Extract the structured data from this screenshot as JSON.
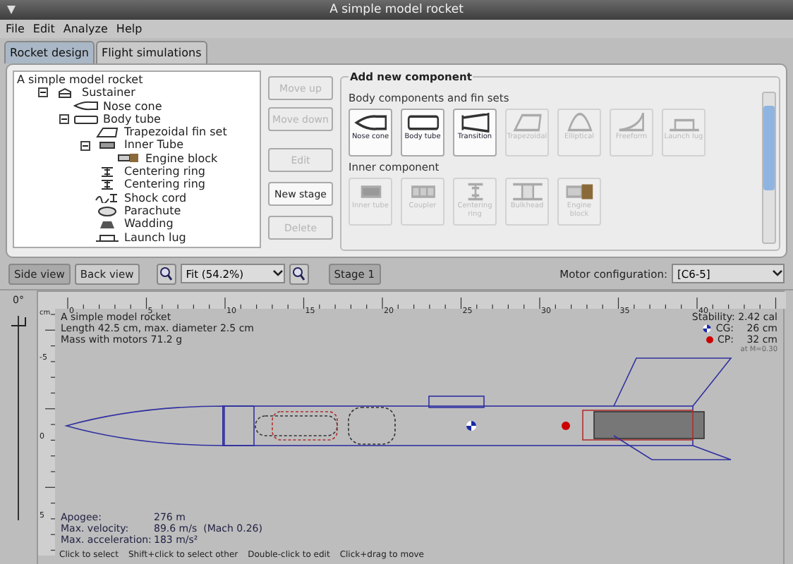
{
  "window": {
    "title": "A simple model rocket"
  },
  "menu": [
    "File",
    "Edit",
    "Analyze",
    "Help"
  ],
  "tabs": [
    {
      "label": "Rocket design",
      "selected": true
    },
    {
      "label": "Flight simulations",
      "selected": false
    }
  ],
  "tree": {
    "label": "A simple model rocket",
    "children": [
      {
        "label": "Sustainer",
        "kind": "stage",
        "expanded": true,
        "children": [
          {
            "label": "Nose cone",
            "kind": "nose"
          },
          {
            "label": "Body tube",
            "kind": "tube",
            "expanded": true,
            "children": [
              {
                "label": "Trapezoidal fin set",
                "kind": "fin"
              },
              {
                "label": "Inner Tube",
                "kind": "inner",
                "expanded": true,
                "children": [
                  {
                    "label": "Engine block",
                    "kind": "engine"
                  }
                ]
              },
              {
                "label": "Centering ring",
                "kind": "ring"
              },
              {
                "label": "Centering ring",
                "kind": "ring"
              },
              {
                "label": "Shock cord",
                "kind": "cord"
              },
              {
                "label": "Parachute",
                "kind": "chute"
              },
              {
                "label": "Wadding",
                "kind": "wadding"
              },
              {
                "label": "Launch lug",
                "kind": "lug"
              }
            ]
          }
        ]
      }
    ]
  },
  "actions": [
    {
      "label": "Move up",
      "disabled": true
    },
    {
      "label": "Move down",
      "disabled": true
    },
    {
      "label": "Edit",
      "disabled": true
    },
    {
      "label": "New stage",
      "disabled": false
    },
    {
      "label": "Delete",
      "disabled": true
    }
  ],
  "add_component": {
    "title": "Add new component",
    "groups": [
      {
        "title": "Body components and fin sets",
        "items": [
          {
            "label": "Nose cone",
            "kind": "nose",
            "disabled": false
          },
          {
            "label": "Body tube",
            "kind": "tube",
            "disabled": false
          },
          {
            "label": "Transition",
            "kind": "transition",
            "disabled": false
          },
          {
            "label": "Trapezoidal",
            "kind": "fin",
            "disabled": true
          },
          {
            "label": "Elliptical",
            "kind": "elliptical",
            "disabled": true
          },
          {
            "label": "Freeform",
            "kind": "freeform",
            "disabled": true
          },
          {
            "label": "Launch lug",
            "kind": "lug",
            "disabled": true
          }
        ]
      },
      {
        "title": "Inner component",
        "items": [
          {
            "label": "Inner tube",
            "kind": "inner",
            "disabled": true
          },
          {
            "label": "Coupler",
            "kind": "coupler",
            "disabled": true
          },
          {
            "label": "Centering ring",
            "kind": "ring",
            "disabled": true
          },
          {
            "label": "Bulkhead",
            "kind": "bulkhead",
            "disabled": true
          },
          {
            "label": "Engine block",
            "kind": "engine",
            "disabled": true
          }
        ]
      }
    ]
  },
  "toolbar": {
    "views": [
      {
        "label": "Side view",
        "selected": true
      },
      {
        "label": "Back view",
        "selected": false
      }
    ],
    "zoom": "Fit (54.2%)",
    "stage": "Stage 1",
    "motor_label": "Motor configuration:",
    "motor": "[C6-5]"
  },
  "view": {
    "angle": "0°",
    "rotation": {
      "level": 0
    },
    "unit": "cm",
    "xticks": [
      "0",
      "5",
      "10",
      "15",
      "20",
      "25",
      "30",
      "35",
      "40"
    ],
    "yticks": [
      "-5",
      "0",
      "5"
    ],
    "info": [
      "A simple model rocket",
      "Length 42.5 cm, max. diameter 2.5 cm",
      "Mass with motors  71.2 g"
    ],
    "stability": "Stability: 2.42 cal",
    "cg": {
      "label": "CG:",
      "value": "26 cm"
    },
    "cp": {
      "label": "CP:",
      "value": "32 cm"
    },
    "mach": "at M=0.30",
    "flight": [
      {
        "label": "Apogee:",
        "value": "276 m"
      },
      {
        "label": "Max. velocity:",
        "value": "89.6 m/s  (Mach 0.26)"
      },
      {
        "label": "Max. acceleration:",
        "value": "183 m/s²"
      }
    ]
  },
  "hints": [
    "Click to select",
    "Shift+click to select other",
    "Double-click to edit",
    "Click+drag to move"
  ]
}
